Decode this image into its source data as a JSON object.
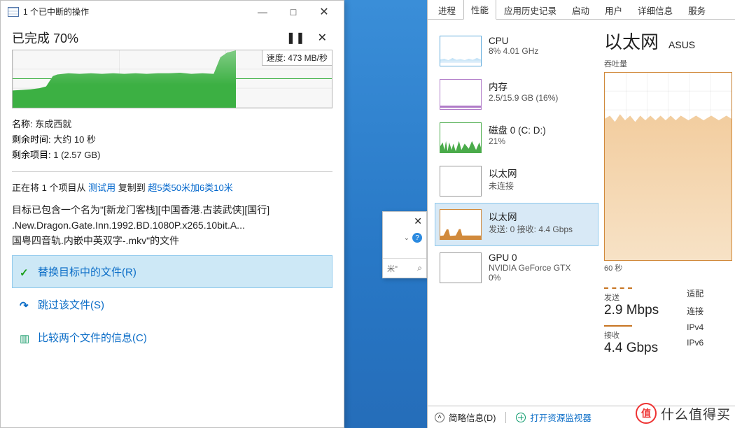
{
  "copy_window": {
    "title": "1 个已中断的操作",
    "progress_title": "已完成 70%",
    "controls": {
      "pause_glyph": "❚❚",
      "cancel_glyph": "✕"
    },
    "speed_label": "速度: 473 MB/秒",
    "name_label": "名称: ",
    "name_value": "东成西就",
    "time_label": "剩余时间: ",
    "time_value": "大约 10 秒",
    "items_label": "剩余项目: ",
    "items_value": "1 (2.57 GB)",
    "moving_prefix": "正在将 1 个项目从 ",
    "moving_src": "测试用",
    "moving_mid": " 复制到 ",
    "moving_dst": "超5类50米加6类10米",
    "info_l1": "目标已包含一个名为\"[新龙门客栈][中国香港.古装武侠][国行]",
    "info_l2": ".New.Dragon.Gate.Inn.1992.BD.1080P.x265.10bit.A...",
    "info_l3": "国粤四音轨.内嵌中英双字-.mkv\"的文件",
    "options": [
      {
        "id": "replace",
        "label": "替换目标中的文件(R)"
      },
      {
        "id": "skip",
        "label": "跳过该文件(S)"
      },
      {
        "id": "compare",
        "label": "比较两个文件的信息(C)"
      }
    ]
  },
  "mini_popup": {
    "close_glyph": "✕",
    "chev_glyph": "⌄",
    "help_glyph": "?",
    "search_hint": "米\"",
    "search_glyph": "⌕"
  },
  "task_manager": {
    "tabs": [
      "进程",
      "性能",
      "应用历史记录",
      "启动",
      "用户",
      "详细信息",
      "服务"
    ],
    "active_tab_index": 1,
    "list": [
      {
        "id": "cpu",
        "name": "CPU",
        "sub": "8% 4.01 GHz"
      },
      {
        "id": "mem",
        "name": "内存",
        "sub": "2.5/15.9 GB (16%)"
      },
      {
        "id": "disk",
        "name": "磁盘 0 (C: D:)",
        "sub": "21%"
      },
      {
        "id": "eth0",
        "name": "以太网",
        "sub": "未连接"
      },
      {
        "id": "eth1",
        "name": "以太网",
        "sub": "发送: 0 接收: 4.4 Gbps"
      },
      {
        "id": "gpu",
        "name": "GPU 0",
        "sub": "NVIDIA GeForce GTX",
        "sub2": "0%"
      }
    ],
    "selected_index": 4,
    "detail": {
      "heading": "以太网",
      "model": "ASUS",
      "subheading": "吞吐量",
      "x_tick": "60 秒",
      "send_label": "发送",
      "send_value": "2.9 Mbps",
      "recv_label": "接收",
      "recv_value": "4.4 Gbps",
      "side": {
        "s1": "适配",
        "s2": "连接",
        "s3": "IPv4",
        "s4": "IPv6"
      }
    },
    "footer": {
      "brief": "简略信息(D)",
      "resmon": "打开资源监视器"
    }
  },
  "watermark": {
    "logo": "值",
    "text": "什么值得买"
  },
  "chart_data": [
    {
      "type": "area",
      "title": "文件复制速度",
      "ylabel": "MB/秒",
      "current_speed": 473,
      "progress_percent": 70,
      "x": [
        0,
        5,
        10,
        15,
        18,
        20,
        30,
        40,
        50,
        60,
        65,
        70
      ],
      "values": [
        20,
        40,
        55,
        80,
        260,
        270,
        275,
        270,
        275,
        275,
        470,
        473
      ],
      "ylim": [
        0,
        500
      ]
    },
    {
      "type": "area",
      "title": "以太网 吞吐量",
      "series": [
        {
          "name": "接收",
          "unit": "Gbps",
          "x": [
            0,
            5,
            10,
            15,
            20,
            25,
            30,
            35,
            40,
            45,
            50,
            55,
            60
          ],
          "values": [
            4.4,
            4.3,
            4.5,
            4.3,
            4.5,
            4.3,
            4.5,
            4.3,
            4.5,
            4.3,
            4.5,
            4.3,
            4.4
          ]
        },
        {
          "name": "发送",
          "unit": "Mbps",
          "x": [
            0,
            60
          ],
          "values": [
            2.9,
            2.9
          ]
        }
      ],
      "xlim": [
        0,
        60
      ],
      "xlabel": "60 秒",
      "ylim_recv_gbps": [
        0,
        5
      ]
    }
  ]
}
